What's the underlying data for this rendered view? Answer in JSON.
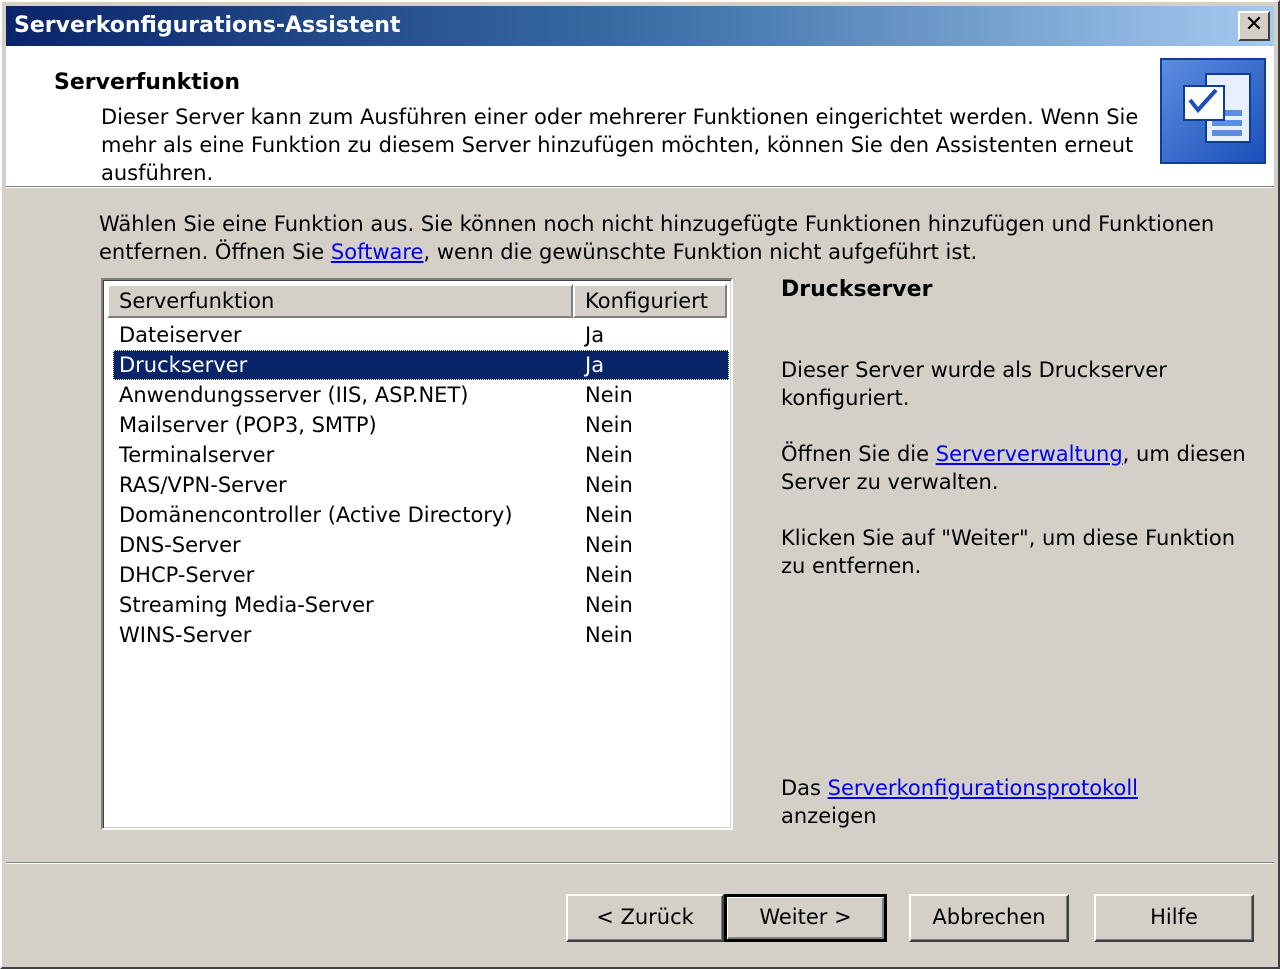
{
  "window": {
    "title": "Serverkonfigurations-Assistent",
    "close_glyph": "✕"
  },
  "header": {
    "title": "Serverfunktion",
    "description": "Dieser Server kann zum Ausführen einer oder mehrerer Funktionen eingerichtet werden. Wenn Sie mehr als eine Funktion zu diesem Server hinzufügen möchten, können Sie den Assistenten erneut ausführen.",
    "icon": "server-wizard-icon"
  },
  "intro": {
    "text_before": "Wählen Sie eine Funktion aus. Sie können noch nicht hinzugefügte Funktionen hinzufügen und Funktionen entfernen. Öffnen Sie ",
    "link": "Software",
    "text_after": ", wenn die gewünschte Funktion nicht aufgeführt ist."
  },
  "list": {
    "columns": [
      "Serverfunktion",
      "Konfiguriert"
    ],
    "rows": [
      {
        "name": "Dateiserver",
        "configured": "Ja"
      },
      {
        "name": "Druckserver",
        "configured": "Ja",
        "selected": true
      },
      {
        "name": "Anwendungsserver (IIS, ASP.NET)",
        "configured": "Nein"
      },
      {
        "name": "Mailserver (POP3, SMTP)",
        "configured": "Nein"
      },
      {
        "name": "Terminalserver",
        "configured": "Nein"
      },
      {
        "name": "RAS/VPN-Server",
        "configured": "Nein"
      },
      {
        "name": "Domänencontroller (Active Directory)",
        "configured": "Nein"
      },
      {
        "name": "DNS-Server",
        "configured": "Nein"
      },
      {
        "name": "DHCP-Server",
        "configured": "Nein"
      },
      {
        "name": "Streaming Media-Server",
        "configured": "Nein"
      },
      {
        "name": "WINS-Server",
        "configured": "Nein"
      }
    ]
  },
  "details": {
    "title": "Druckserver",
    "line1": "Dieser Server wurde als Druckserver konfiguriert.",
    "line2_before": "Öffnen Sie die ",
    "line2_link": "Serververwaltung",
    "line2_after": ", um diesen Server zu verwalten.",
    "line3": "Klicken Sie auf \"Weiter\", um diese Funktion zu entfernen.",
    "log_before": "Das ",
    "log_link": "Serverkonfigurationsprotokoll",
    "log_after": " anzeigen"
  },
  "buttons": {
    "back": "< Zurück",
    "next": "Weiter >",
    "cancel": "Abbrechen",
    "help": "Hilfe"
  },
  "colors": {
    "title_bar": "#0a246a",
    "selection": "#0a246a",
    "link": "#0000ee",
    "face": "#d4d0c8"
  }
}
